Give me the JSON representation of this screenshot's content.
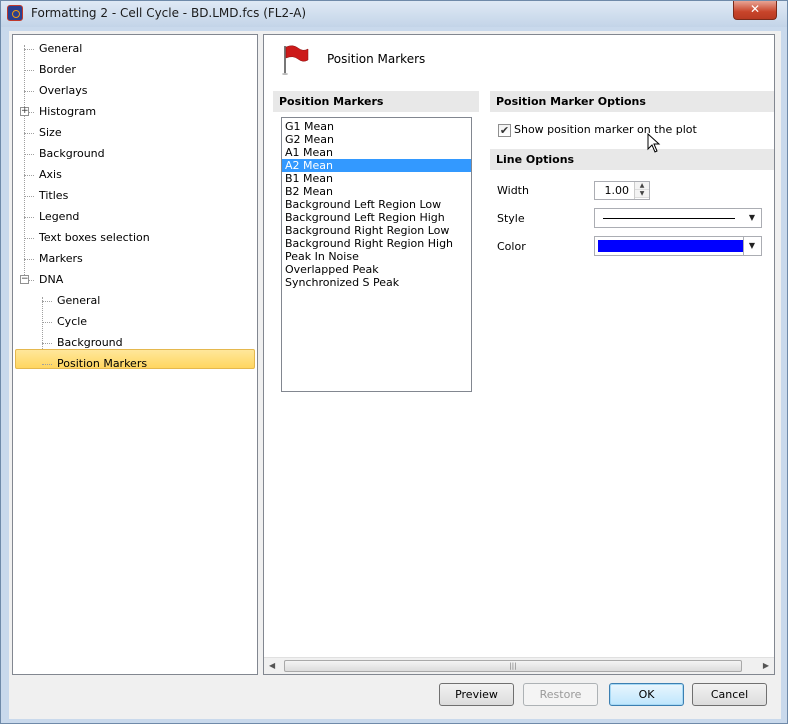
{
  "window": {
    "title": "Formatting 2 - Cell Cycle - BD.LMD.fcs (FL2-A)",
    "close_label": "✕"
  },
  "tree": {
    "items": [
      {
        "label": "General"
      },
      {
        "label": "Border"
      },
      {
        "label": "Overlays"
      },
      {
        "label": "Histogram",
        "expander": "+"
      },
      {
        "label": "Size"
      },
      {
        "label": "Background"
      },
      {
        "label": "Axis"
      },
      {
        "label": "Titles"
      },
      {
        "label": "Legend"
      },
      {
        "label": "Text boxes selection"
      },
      {
        "label": "Markers"
      },
      {
        "label": "DNA",
        "expander": "−"
      },
      {
        "label": "General",
        "child": true
      },
      {
        "label": "Cycle",
        "child": true
      },
      {
        "label": "Background",
        "child": true
      },
      {
        "label": "Position Markers",
        "child": true,
        "selected": true
      }
    ]
  },
  "panel": {
    "title": "Position Markers",
    "icon": "red-flag-icon",
    "markers_header": "Position Markers",
    "markers": [
      "G1 Mean",
      "G2 Mean",
      "A1 Mean",
      "A2 Mean",
      "B1 Mean",
      "B2 Mean",
      "Background Left Region Low",
      "Background Left Region High",
      "Background Right Region Low",
      "Background Right Region High",
      "Peak In Noise",
      "Overlapped Peak",
      "Synchronized S Peak"
    ],
    "selected_marker": "A2 Mean",
    "options_header": "Position Marker Options",
    "show_marker_label": "Show position marker on the plot",
    "show_marker_checked": true,
    "line_header": "Line Options",
    "width_label": "Width",
    "width_value": "1.00",
    "style_label": "Style",
    "style_value": "solid-line",
    "color_label": "Color",
    "color_value": "#0000ff"
  },
  "buttons": {
    "preview": "Preview",
    "restore": "Restore",
    "ok": "OK",
    "cancel": "Cancel"
  }
}
